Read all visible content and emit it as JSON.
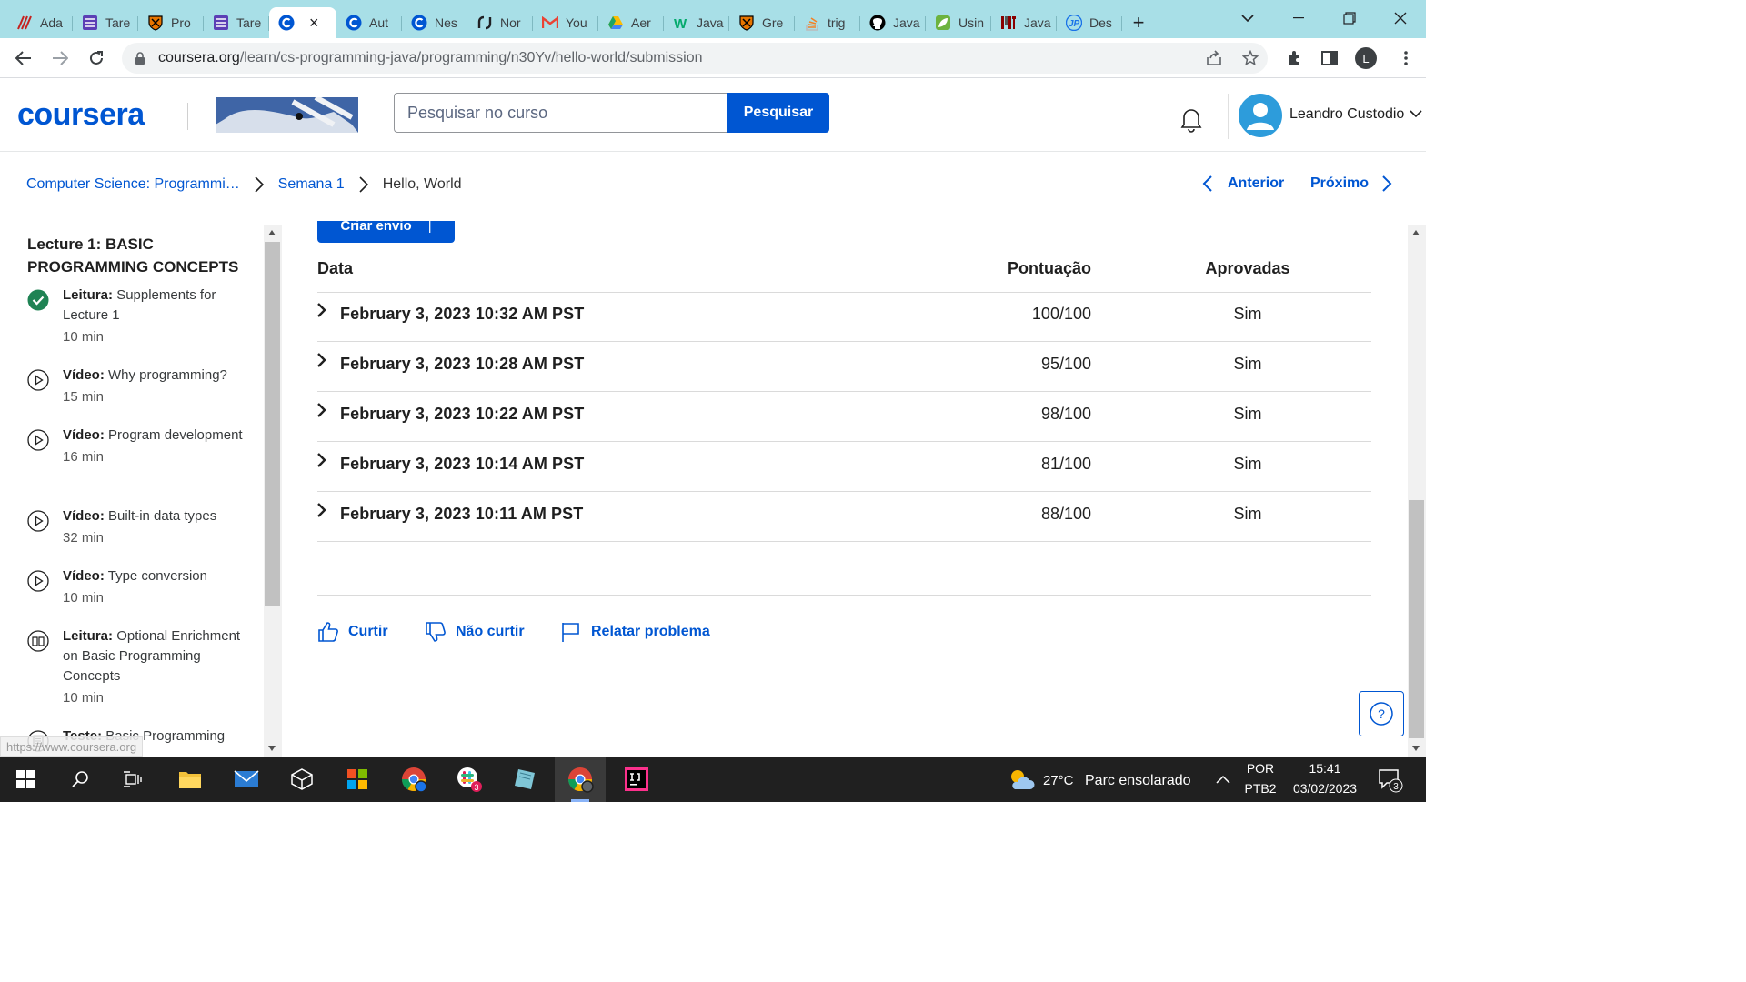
{
  "browser": {
    "tabs": [
      {
        "title": "Ada",
        "icon": "paint-icon",
        "color": "#c5221f"
      },
      {
        "title": "Tare",
        "icon": "classroom-icon",
        "color": "#5b3fb5"
      },
      {
        "title": "Pro",
        "icon": "princeton-icon",
        "color": "#000000"
      },
      {
        "title": "Tare",
        "icon": "classroom-icon",
        "color": "#5b3fb5"
      },
      {
        "title": "",
        "icon": "coursera-icon",
        "color": "#0056d2",
        "active": true
      },
      {
        "title": "Aut",
        "icon": "coursera-icon",
        "color": "#0056d2"
      },
      {
        "title": "Nes",
        "icon": "coursera-icon",
        "color": "#0056d2"
      },
      {
        "title": "Nor",
        "icon": "link-icon",
        "color": "#202124"
      },
      {
        "title": "You",
        "icon": "gmail-icon",
        "color": "#ea4335"
      },
      {
        "title": "Aer",
        "icon": "drive-icon",
        "color": "#1fa463"
      },
      {
        "title": "Java",
        "icon": "w3-icon",
        "color": "#04aa6d"
      },
      {
        "title": "Gre",
        "icon": "princeton-icon",
        "color": "#000000"
      },
      {
        "title": "trig",
        "icon": "stack-icon",
        "color": "#f48024"
      },
      {
        "title": "Java",
        "icon": "github-icon",
        "color": "#000000"
      },
      {
        "title": "Usin",
        "icon": "leaf-icon",
        "color": "#2e7d32"
      },
      {
        "title": "Java",
        "icon": "mit-icon",
        "color": "#8a0000"
      },
      {
        "title": "Des",
        "icon": "jp-icon",
        "color": "#1a73e8"
      }
    ],
    "active_tab_close": "×",
    "new_tab": "+",
    "url_host": "coursera.org",
    "url_path": "/learn/cs-programming-java/programming/n30Yv/hello-world/submission",
    "profile_initial": "L"
  },
  "header": {
    "logo": "coursera",
    "search_placeholder": "Pesquisar no curso",
    "search_button": "Pesquisar",
    "user_name": "Leandro Custodio"
  },
  "breadcrumb": {
    "course": "Computer Science: Programmi…",
    "week": "Semana 1",
    "current": "Hello, World",
    "prev": "Anterior",
    "next": "Próximo"
  },
  "sidebar": {
    "section_title": "Lecture 1: BASIC PROGRAMMING CONCEPTS",
    "items": [
      {
        "type": "Leitura:",
        "title": "Supplements for Lecture 1",
        "time": "10 min",
        "icon": "completed-check-icon"
      },
      {
        "type": "Vídeo:",
        "title": "Why programming?",
        "time": "15 min",
        "icon": "play-circle-icon"
      },
      {
        "type": "Vídeo:",
        "title": "Program development",
        "time": "16 min",
        "icon": "play-circle-icon"
      },
      {
        "type": "Vídeo:",
        "title": "Built-in data types",
        "time": "32 min",
        "icon": "play-circle-icon"
      },
      {
        "type": "Vídeo:",
        "title": "Type conversion",
        "time": "10 min",
        "icon": "play-circle-icon"
      },
      {
        "type": "Leitura:",
        "title": "Optional Enrichment on Basic Programming Concepts",
        "time": "10 min",
        "icon": "book-icon"
      },
      {
        "type": "Teste:",
        "title": "Basic Programming",
        "time": "",
        "icon": "quiz-icon"
      }
    ],
    "hover_url": "https://www.coursera.org"
  },
  "submissions": {
    "create_button": "Criar envio",
    "headers": {
      "date": "Data",
      "score": "Pontuação",
      "passed": "Aprovadas"
    },
    "rows": [
      {
        "date": "February 3, 2023 10:32 AM PST",
        "score": "100/100",
        "passed": "Sim"
      },
      {
        "date": "February 3, 2023 10:28 AM PST",
        "score": "95/100",
        "passed": "Sim"
      },
      {
        "date": "February 3, 2023 10:22 AM PST",
        "score": "98/100",
        "passed": "Sim"
      },
      {
        "date": "February 3, 2023 10:14 AM PST",
        "score": "81/100",
        "passed": "Sim"
      },
      {
        "date": "February 3, 2023 10:11 AM PST",
        "score": "88/100",
        "passed": "Sim"
      }
    ]
  },
  "feedback": {
    "like": "Curtir",
    "dislike": "Não curtir",
    "report": "Relatar problema"
  },
  "help_button": "?",
  "taskbar": {
    "weather_temp": "27°C",
    "weather_text": "Parc ensolarado",
    "lang_top": "POR",
    "lang_bottom": "PTB2",
    "time": "15:41",
    "date": "03/02/2023",
    "notification_count": "3",
    "slack_badge": "3"
  }
}
